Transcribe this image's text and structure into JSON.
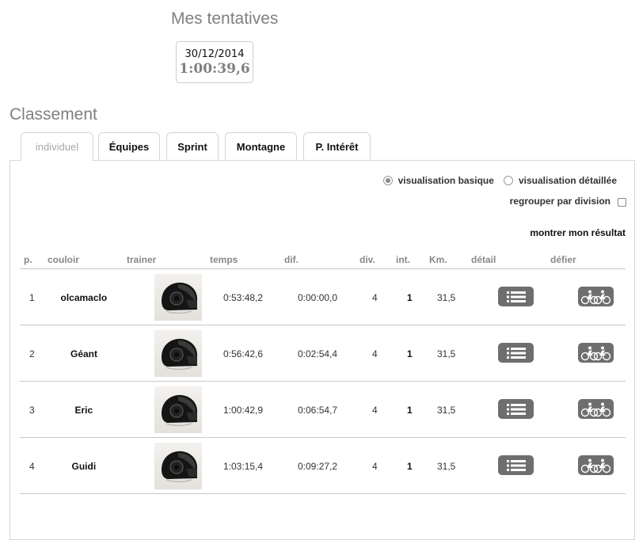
{
  "attempts": {
    "title": "Mes tentatives",
    "items": [
      {
        "date": "30/12/2014",
        "time": "1:00:39,6"
      }
    ]
  },
  "ranking": {
    "title": "Classement",
    "tabs": [
      {
        "label": "individuel",
        "active": true
      },
      {
        "label": "Équipes",
        "active": false
      },
      {
        "label": "Sprint",
        "active": false
      },
      {
        "label": "Montagne",
        "active": false
      },
      {
        "label": "P. Intérêt",
        "active": false
      }
    ],
    "options": {
      "basic_label": "visualisation basique",
      "detailed_label": "visualisation détaillée",
      "selected": "basique",
      "group_label": "regrouper par division",
      "group_checked": false
    },
    "show_result_label": "montrer mon résultat",
    "columns": [
      "p.",
      "couloir",
      "trainer",
      "temps",
      "dif.",
      "div.",
      "int.",
      "Km.",
      "détail",
      "défier"
    ],
    "rows": [
      {
        "pos": "1",
        "name": "olcamaclo",
        "time": "0:53:48,2",
        "diff": "0:00:00,0",
        "div": "4",
        "int": "1",
        "km": "31,5"
      },
      {
        "pos": "2",
        "name": "Géant",
        "time": "0:56:42,6",
        "diff": "0:02:54,4",
        "div": "4",
        "int": "1",
        "km": "31,5"
      },
      {
        "pos": "3",
        "name": "Eric",
        "time": "1:00:42,9",
        "diff": "0:06:54,7",
        "div": "4",
        "int": "1",
        "km": "31,5"
      },
      {
        "pos": "4",
        "name": "Guidi",
        "time": "1:03:15,4",
        "diff": "0:09:27,2",
        "div": "4",
        "int": "1",
        "km": "31,5"
      }
    ],
    "icons": {
      "trainer": "helmet-icon",
      "detail": "list-icon",
      "defy": "cyclists-icon"
    },
    "colors": {
      "button": "#6e6e6e",
      "muted": "#808080"
    }
  }
}
